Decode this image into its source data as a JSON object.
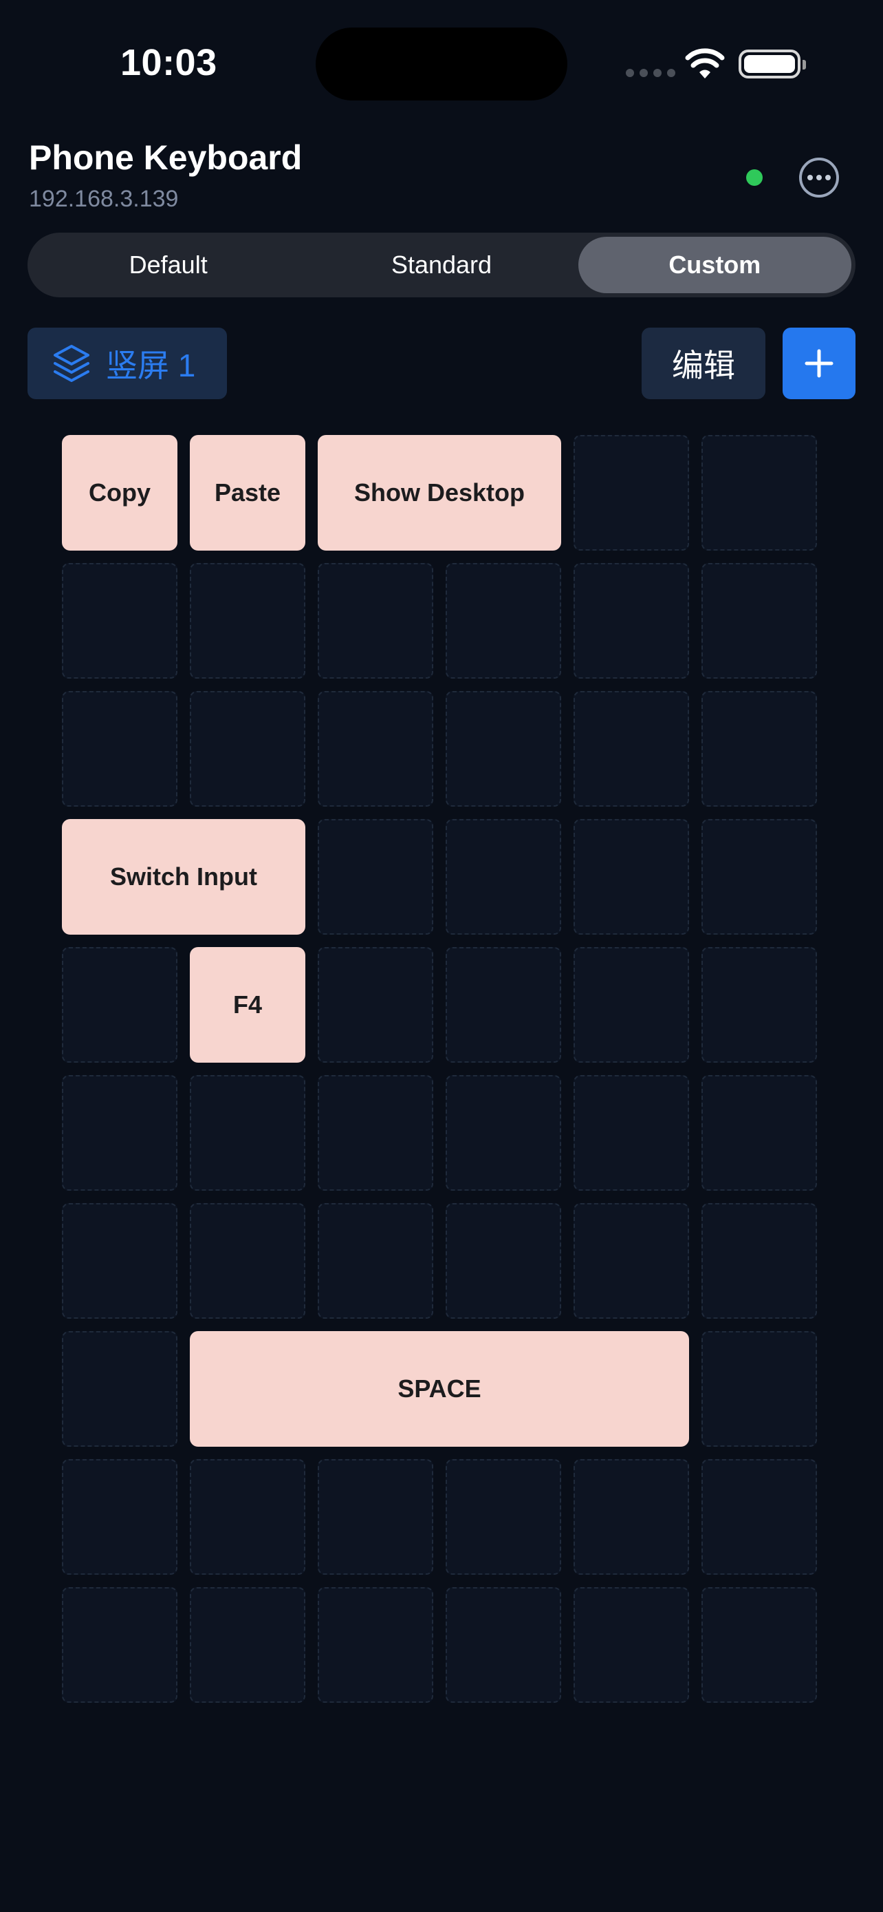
{
  "status_bar": {
    "time": "10:03"
  },
  "header": {
    "title": "Phone Keyboard",
    "ip": "192.168.3.139",
    "connection_color": "#2fc95a"
  },
  "tabs": [
    {
      "label": "Default",
      "active": false
    },
    {
      "label": "Standard",
      "active": false
    },
    {
      "label": "Custom",
      "active": true
    }
  ],
  "toolbar": {
    "layer_label": "竖屏 1",
    "edit_label": "编辑",
    "add_icon": "plus-icon"
  },
  "grid": {
    "columns": 6,
    "rows": 10,
    "keys": [
      {
        "label": "Copy",
        "row": 1,
        "col": 1,
        "colspan": 1
      },
      {
        "label": "Paste",
        "row": 1,
        "col": 2,
        "colspan": 1
      },
      {
        "label": "Show Desktop",
        "row": 1,
        "col": 3,
        "colspan": 2
      },
      {
        "label": "Switch Input",
        "row": 4,
        "col": 1,
        "colspan": 2
      },
      {
        "label": "F4",
        "row": 5,
        "col": 2,
        "colspan": 1
      },
      {
        "label": "SPACE",
        "row": 8,
        "col": 2,
        "colspan": 4
      }
    ]
  },
  "colors": {
    "accent": "#2578ee",
    "key_fill": "#f7d5cf",
    "background": "#090e18"
  }
}
